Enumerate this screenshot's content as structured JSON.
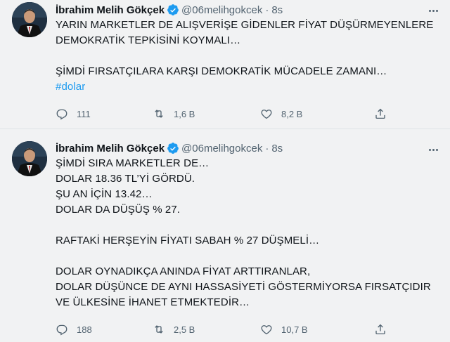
{
  "colors": {
    "accent": "#1d9bf0",
    "muted": "#536471",
    "text": "#0f1419"
  },
  "tweets": [
    {
      "author_name": "İbrahim Melih Gökçek",
      "handle": "@06melihgokcek",
      "separator": "·",
      "time": "8s",
      "lines": [
        "YARIN MARKETLER DE ALIŞVERİŞE GİDENLER FİYAT DÜŞÜRMEYENLERE",
        "DEMOKRATİK TEPKİSİNİ KOYMALI…",
        "",
        "ŞİMDİ FIRSATÇILARA KARŞI DEMOKRATİK MÜCADELE ZAMANI…"
      ],
      "hashtag": "#dolar",
      "replies": "111",
      "retweets": "1,6 B",
      "likes": "8,2 B"
    },
    {
      "author_name": "İbrahim Melih Gökçek",
      "handle": "@06melihgokcek",
      "separator": "·",
      "time": "8s",
      "lines": [
        "ŞİMDİ SIRA MARKETLER DE…",
        "DOLAR 18.36 TL’Yİ GÖRDÜ.",
        "ŞU AN İÇİN 13.42…",
        "DOLAR DA DÜŞÜŞ % 27.",
        "",
        "RAFTAKİ HERŞEYİN FİYATI  SABAH % 27 DÜŞMELİ…",
        "",
        "DOLAR OYNADIKÇA ANINDA FİYAT ARTTIRANLAR,",
        "DOLAR DÜŞÜNCE DE AYNI HASSASİYETİ GÖSTERMİYORSA FIRSATÇIDIR",
        "VE ÜLKESİNE İHANET ETMEKTEDİR…"
      ],
      "replies": "188",
      "retweets": "2,5 B",
      "likes": "10,7 B"
    }
  ]
}
